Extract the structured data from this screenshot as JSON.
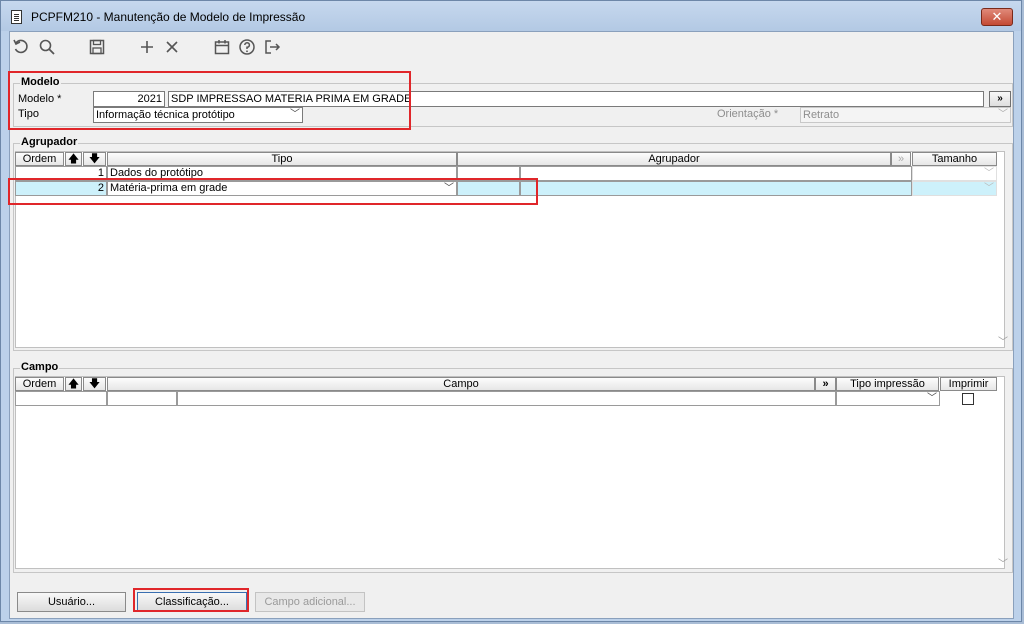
{
  "window": {
    "title": "PCPFM210 - Manutenção de Modelo de Impressão",
    "close": "✕"
  },
  "toolbar": [
    "undo-icon",
    "search-icon",
    "save-icon",
    "add-icon",
    "delete-icon",
    "calendar-icon",
    "help-icon",
    "exit-icon"
  ],
  "modelo": {
    "section": "Modelo",
    "modelo_label": "Modelo *",
    "modelo_code": "2021",
    "modelo_desc": "SDP IMPRESSAO MATERIA PRIMA EM GRADE",
    "lookup": "»",
    "tipo_label": "Tipo",
    "tipo_value": "Informação técnica protótipo",
    "orientacao_label": "Orientação *",
    "orientacao_value": "Retrato"
  },
  "agrupador": {
    "section": "Agrupador",
    "headers": {
      "ordem": "Ordem",
      "tipo": "Tipo",
      "agrupador": "Agrupador",
      "tamanho": "Tamanho"
    },
    "rows": [
      {
        "ordem": "1",
        "tipo": "Dados do protótipo"
      },
      {
        "ordem": "2",
        "tipo": "Matéria-prima em grade"
      }
    ]
  },
  "campo": {
    "section": "Campo",
    "headers": {
      "ordem": "Ordem",
      "campo": "Campo",
      "lookup": "»",
      "tipo_impressao": "Tipo impressão",
      "imprimir": "Imprimir"
    }
  },
  "footer": {
    "usuario": "Usuário...",
    "classificacao": "Classificação...",
    "campo_adicional": "Campo adicional..."
  },
  "colors": {
    "highlight": "#e0262a",
    "selected_row": "#cdf1fb"
  }
}
